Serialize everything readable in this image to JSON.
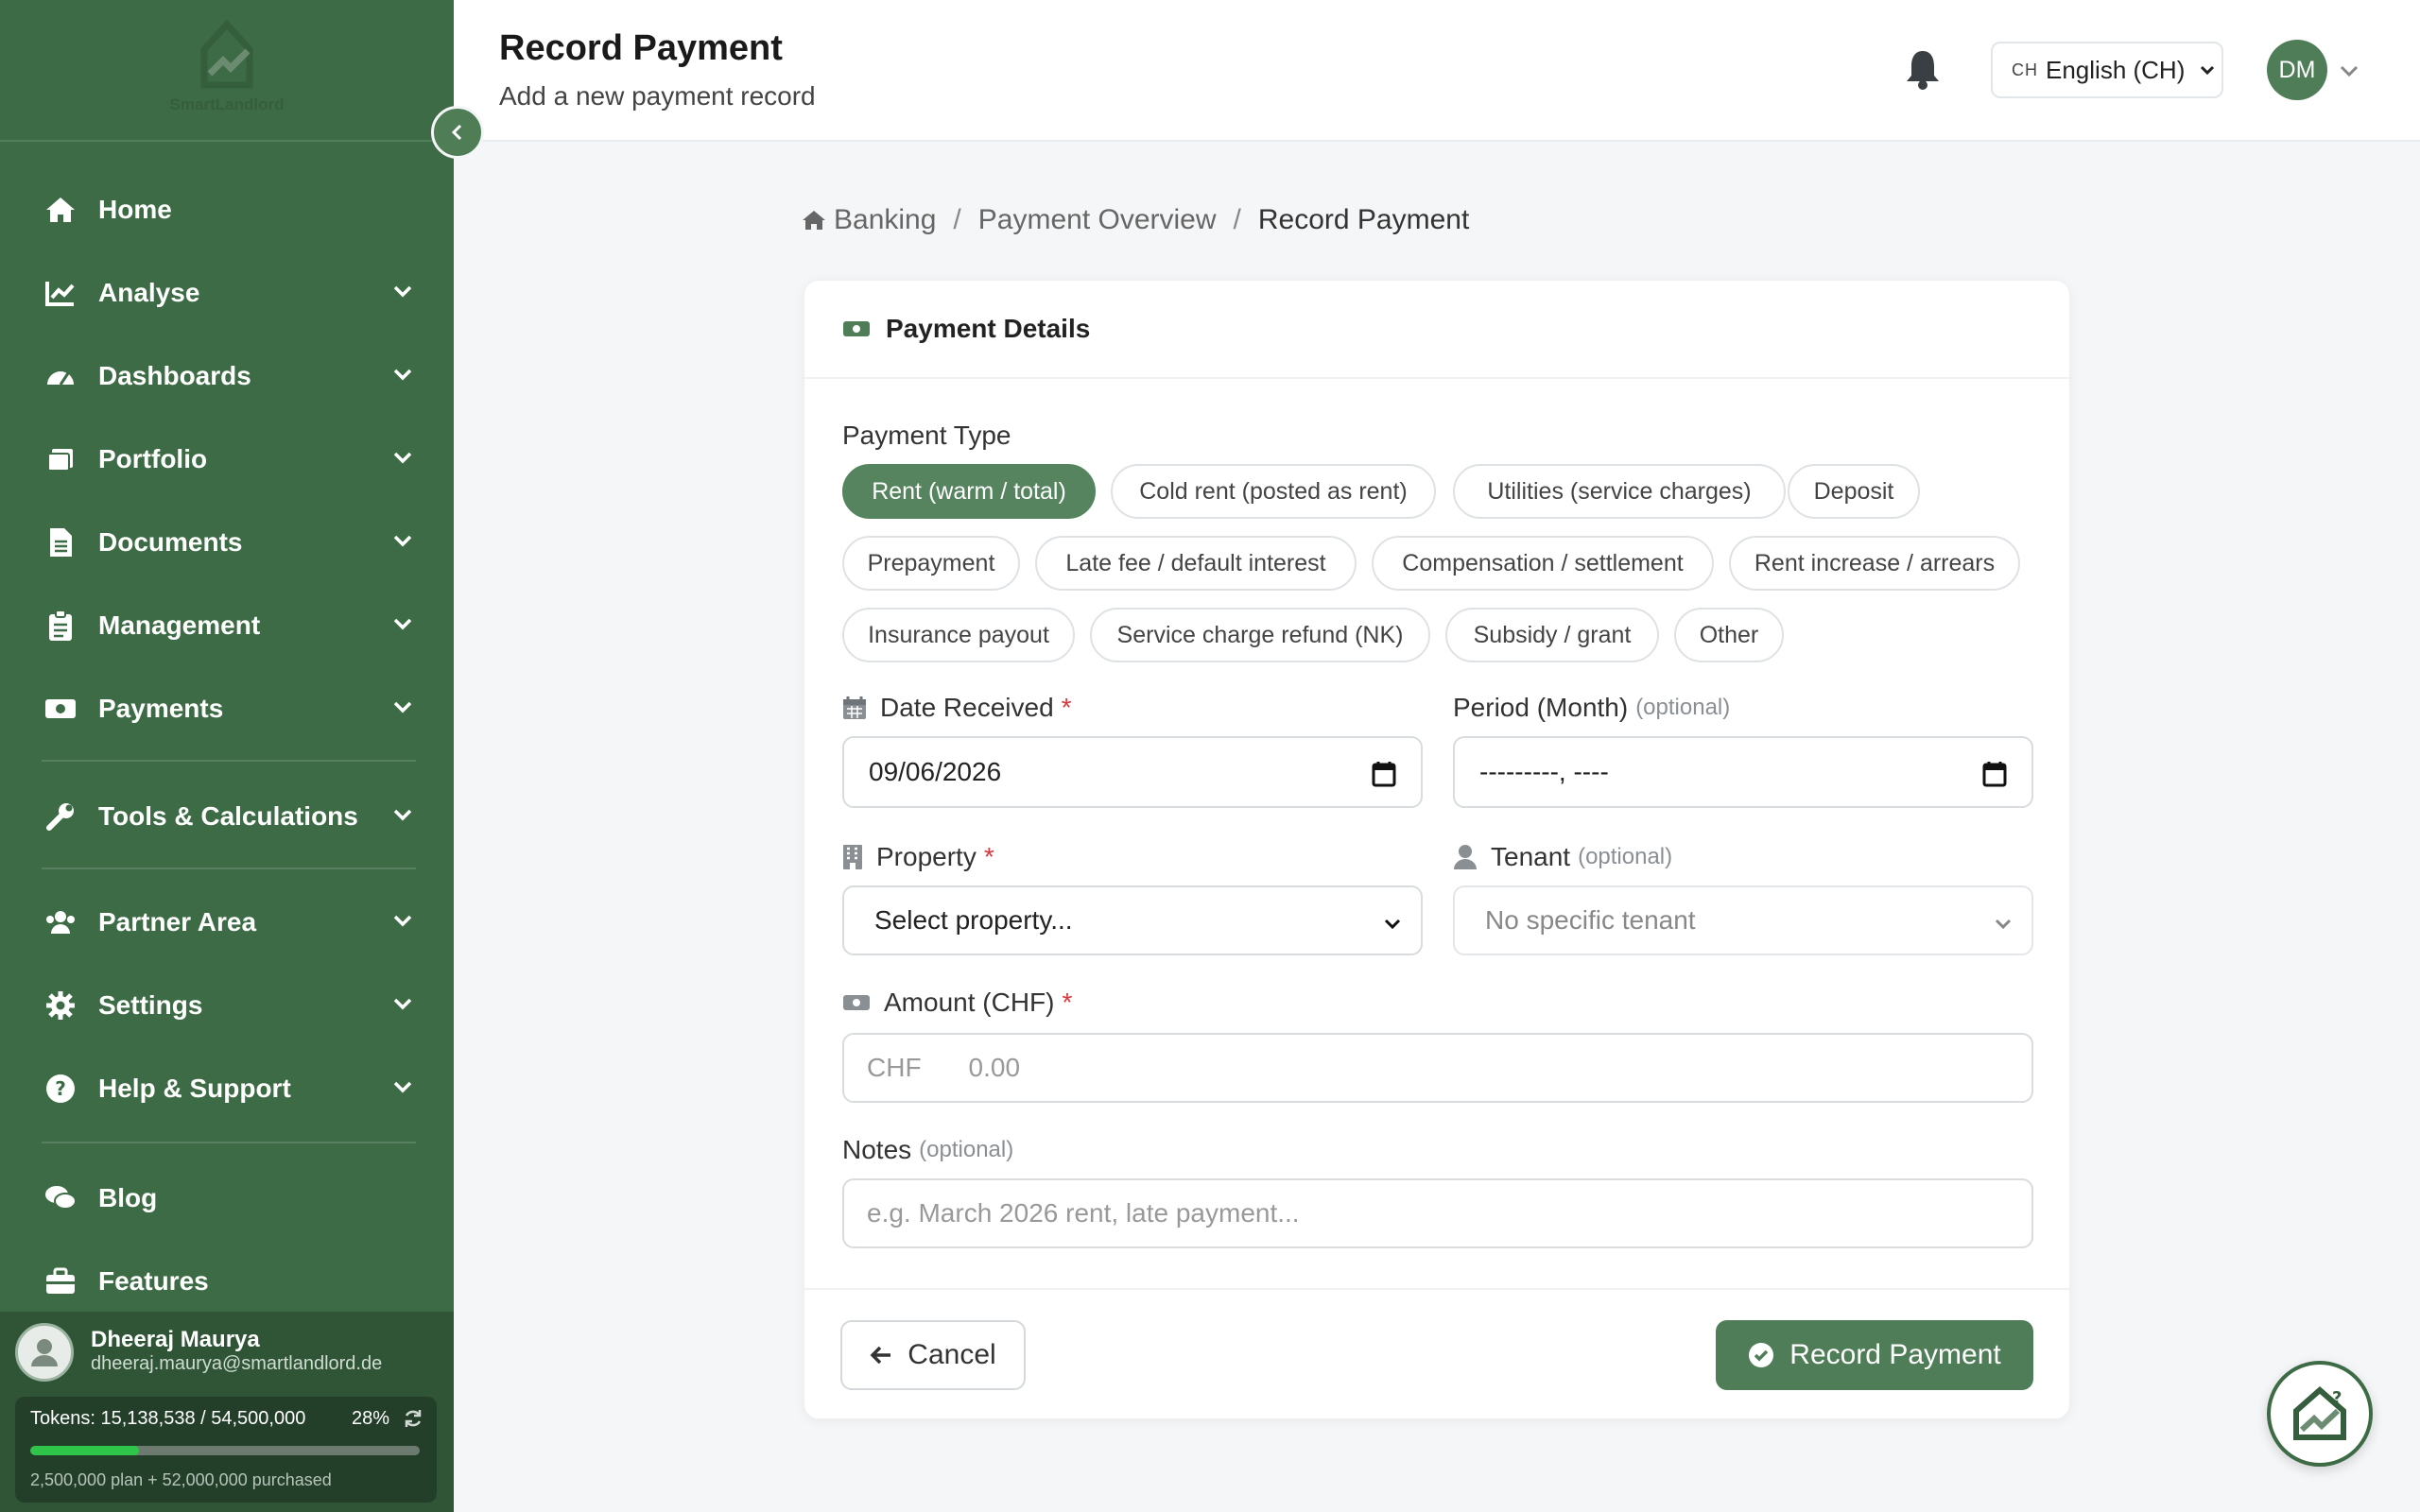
{
  "brand": {
    "logo_text": "SmartLandlord"
  },
  "sidebar": {
    "items": [
      {
        "label": "Home",
        "icon": "home-icon"
      },
      {
        "label": "Analyse",
        "icon": "chart-line-icon"
      },
      {
        "label": "Dashboards",
        "icon": "gauge-icon"
      },
      {
        "label": "Portfolio",
        "icon": "portfolio-icon"
      },
      {
        "label": "Documents",
        "icon": "document-icon"
      },
      {
        "label": "Management",
        "icon": "clipboard-icon"
      },
      {
        "label": "Payments",
        "icon": "money-icon"
      },
      {
        "label": "Tools & Calculations",
        "icon": "wrench-icon"
      },
      {
        "label": "Partner Area",
        "icon": "users-icon"
      },
      {
        "label": "Settings",
        "icon": "gear-icon"
      },
      {
        "label": "Help & Support",
        "icon": "question-icon"
      },
      {
        "label": "Blog",
        "icon": "comments-icon"
      },
      {
        "label": "Features",
        "icon": "briefcase-icon"
      }
    ],
    "user": {
      "name": "Dheeraj Maurya",
      "email": "dheeraj.maurya@smartlandlord.de",
      "tokens_text": "Tokens: 15,138,538 / 54,500,000",
      "tokens_pct": "28%",
      "tokens_fraction": 0.28,
      "tokens_sub": "2,500,000 plan + 52,000,000 purchased"
    }
  },
  "header": {
    "title": "Record Payment",
    "subtitle": "Add a new payment record",
    "language_code": "CH",
    "language": "English (CH)",
    "avatar_initials": "DM"
  },
  "breadcrumb": {
    "items": [
      "Banking",
      "Payment Overview"
    ],
    "current": "Record Payment"
  },
  "form": {
    "card_title": "Payment Details",
    "payment_type_label": "Payment Type",
    "payment_types": [
      "Rent (warm / total)",
      "Cold rent (posted as rent)",
      "Utilities (service charges)",
      "Deposit",
      "Prepayment",
      "Late fee / default interest",
      "Compensation / settlement",
      "Rent increase / arrears",
      "Insurance payout",
      "Service charge refund (NK)",
      "Subsidy / grant",
      "Other"
    ],
    "selected_payment_type": "Rent (warm / total)",
    "date_label": "Date Received",
    "required_mark": "*",
    "date_value": "09/06/2026",
    "period_label": "Period (Month)",
    "optional_text": "(optional)",
    "period_value": "---------, ----",
    "property_label": "Property",
    "property_value": "Select property...",
    "tenant_label": "Tenant",
    "tenant_value": "No specific tenant",
    "amount_label": "Amount (CHF)",
    "amount_prefix": "CHF",
    "amount_placeholder": "0.00",
    "notes_label": "Notes",
    "notes_placeholder": "e.g. March 2026 rent, late payment...",
    "cancel_label": "Cancel",
    "submit_label": "Record Payment"
  },
  "colors": {
    "sidebar": "#3d6b45",
    "accent": "#4f7d57",
    "required": "#d9363e",
    "token_bar": "#2fc54a"
  }
}
